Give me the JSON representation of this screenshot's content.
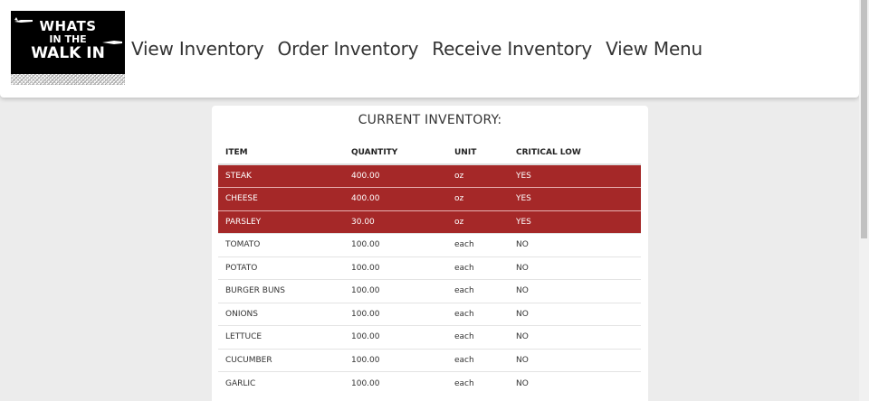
{
  "logo": {
    "line1": "WHATS",
    "line2": "IN THE",
    "line3": "WALK IN"
  },
  "nav": {
    "links": [
      "View Inventory",
      "Order Inventory",
      "Receive Inventory",
      "View Menu"
    ]
  },
  "panel": {
    "title": "CURRENT INVENTORY:",
    "headers": {
      "item": "ITEM",
      "quantity": "QUANTITY",
      "unit": "UNIT",
      "critical": "CRITICAL LOW"
    },
    "rows": [
      {
        "item": "STEAK",
        "quantity": "400.00",
        "unit": "oz",
        "critical": "YES"
      },
      {
        "item": "CHEESE",
        "quantity": "400.00",
        "unit": "oz",
        "critical": "YES"
      },
      {
        "item": "PARSLEY",
        "quantity": "30.00",
        "unit": "oz",
        "critical": "YES"
      },
      {
        "item": "TOMATO",
        "quantity": "100.00",
        "unit": "each",
        "critical": "NO"
      },
      {
        "item": "POTATO",
        "quantity": "100.00",
        "unit": "each",
        "critical": "NO"
      },
      {
        "item": "BURGER BUNS",
        "quantity": "100.00",
        "unit": "each",
        "critical": "NO"
      },
      {
        "item": "ONIONS",
        "quantity": "100.00",
        "unit": "each",
        "critical": "NO"
      },
      {
        "item": "LETTUCE",
        "quantity": "100.00",
        "unit": "each",
        "critical": "NO"
      },
      {
        "item": "CUCUMBER",
        "quantity": "100.00",
        "unit": "each",
        "critical": "NO"
      },
      {
        "item": "GARLIC",
        "quantity": "100.00",
        "unit": "each",
        "critical": "NO"
      }
    ]
  },
  "colors": {
    "critical_row": "#a52828",
    "page_bg": "#ececec"
  }
}
